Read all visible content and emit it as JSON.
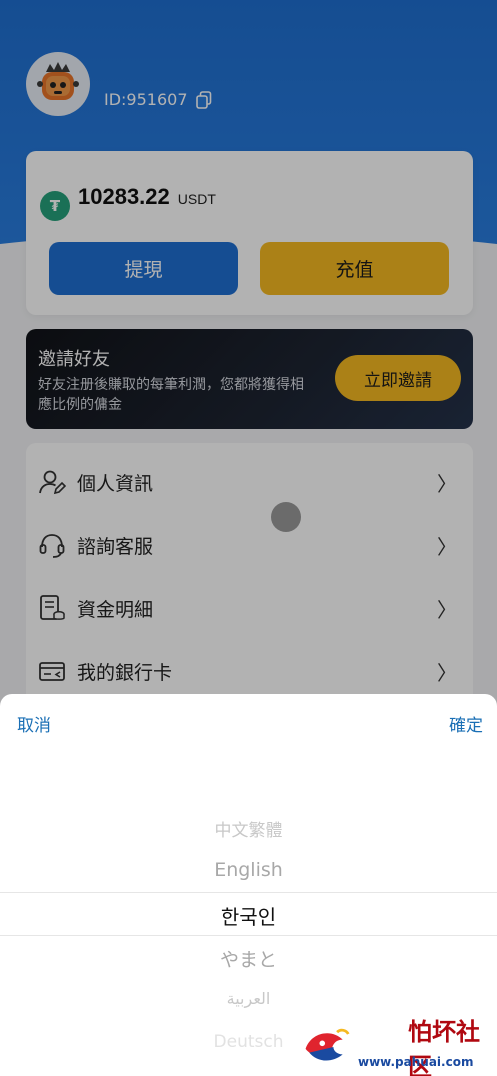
{
  "user": {
    "id_text": "ID:951607"
  },
  "balance": {
    "value": "10283.22",
    "unit": "USDT"
  },
  "actions": {
    "withdraw": "提現",
    "deposit": "充值"
  },
  "invite": {
    "title": "邀請好友",
    "desc": "好友注册後賺取的每筆利潤，您都將獲得相應比例的傭金",
    "button": "立即邀請"
  },
  "menu": {
    "items": [
      {
        "label": "個人資訊",
        "icon": "user-edit-icon"
      },
      {
        "label": "諮詢客服",
        "icon": "headset-icon"
      },
      {
        "label": "資金明細",
        "icon": "ledger-icon"
      },
      {
        "label": "我的銀行卡",
        "icon": "bank-card-icon"
      }
    ]
  },
  "sheet": {
    "cancel": "取消",
    "confirm": "確定",
    "options": [
      "中文繁體",
      "English",
      "한국인",
      "やまと",
      "العربية",
      "Deutsch"
    ],
    "selected_index": 2
  },
  "watermark": {
    "text": "怕坏社区",
    "url": "www.pahuai.com"
  },
  "colors": {
    "primary": "#1f6fd1",
    "accent": "#f5b921",
    "link": "#1a6fb5"
  }
}
